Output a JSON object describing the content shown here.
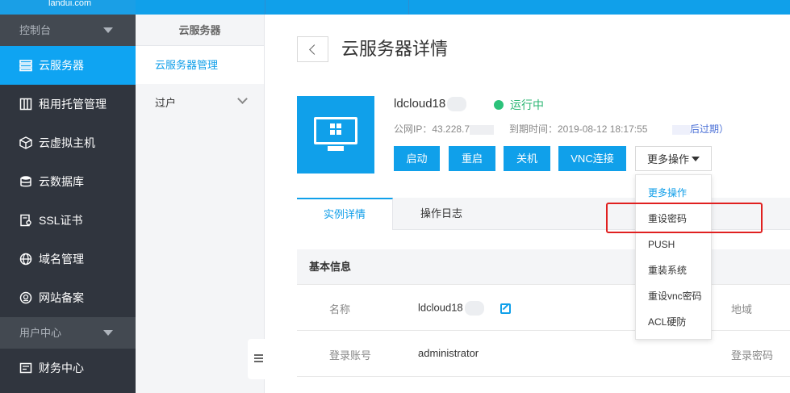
{
  "topbar": {
    "logo_text": "landui.com"
  },
  "sidebar": {
    "group1": "控制台",
    "items": [
      {
        "label": "云服务器",
        "icon": "server-list-icon",
        "active": true
      },
      {
        "label": "租用托管管理",
        "icon": "rack-icon"
      },
      {
        "label": "云虚拟主机",
        "icon": "cube-icon"
      },
      {
        "label": "云数据库",
        "icon": "database-icon"
      },
      {
        "label": "SSL证书",
        "icon": "certificate-icon"
      },
      {
        "label": "域名管理",
        "icon": "globe-icon"
      },
      {
        "label": "网站备案",
        "icon": "seal-icon"
      }
    ],
    "group2": "用户中心",
    "items2": [
      {
        "label": "财务中心",
        "icon": "wallet-icon"
      }
    ]
  },
  "subnav": {
    "title": "云服务器",
    "items": [
      {
        "label": "云服务器管理"
      },
      {
        "label": "过户"
      }
    ]
  },
  "main": {
    "title": "云服务器详情",
    "server": {
      "name": "ldcloud18",
      "status": "运行中",
      "ip_label": "公网IP：43.228.7",
      "expire": "到期时间：2019-08-12 18:17:55",
      "expire_note": "后过期）"
    },
    "buttons": {
      "start": "启动",
      "restart": "重启",
      "shutdown": "关机",
      "vnc": "VNC连接",
      "more": "更多操作"
    },
    "tabs": [
      "实例详情",
      "操作日志"
    ],
    "section": "基本信息",
    "rows": [
      {
        "label": "名称",
        "value": "ldcloud18",
        "right_label": "地域"
      },
      {
        "label": "登录账号",
        "value": "administrator",
        "right_label": "登录密码"
      }
    ]
  },
  "dropdown": {
    "items": [
      "更多操作",
      "重设密码",
      "PUSH",
      "重装系统",
      "重设vnc密码",
      "ACL硬防"
    ]
  },
  "colors": {
    "accent": "#10a0ea",
    "sidebar_bg": "#30353e",
    "status_green": "#2bc27a",
    "highlight_red": "#e02020"
  }
}
